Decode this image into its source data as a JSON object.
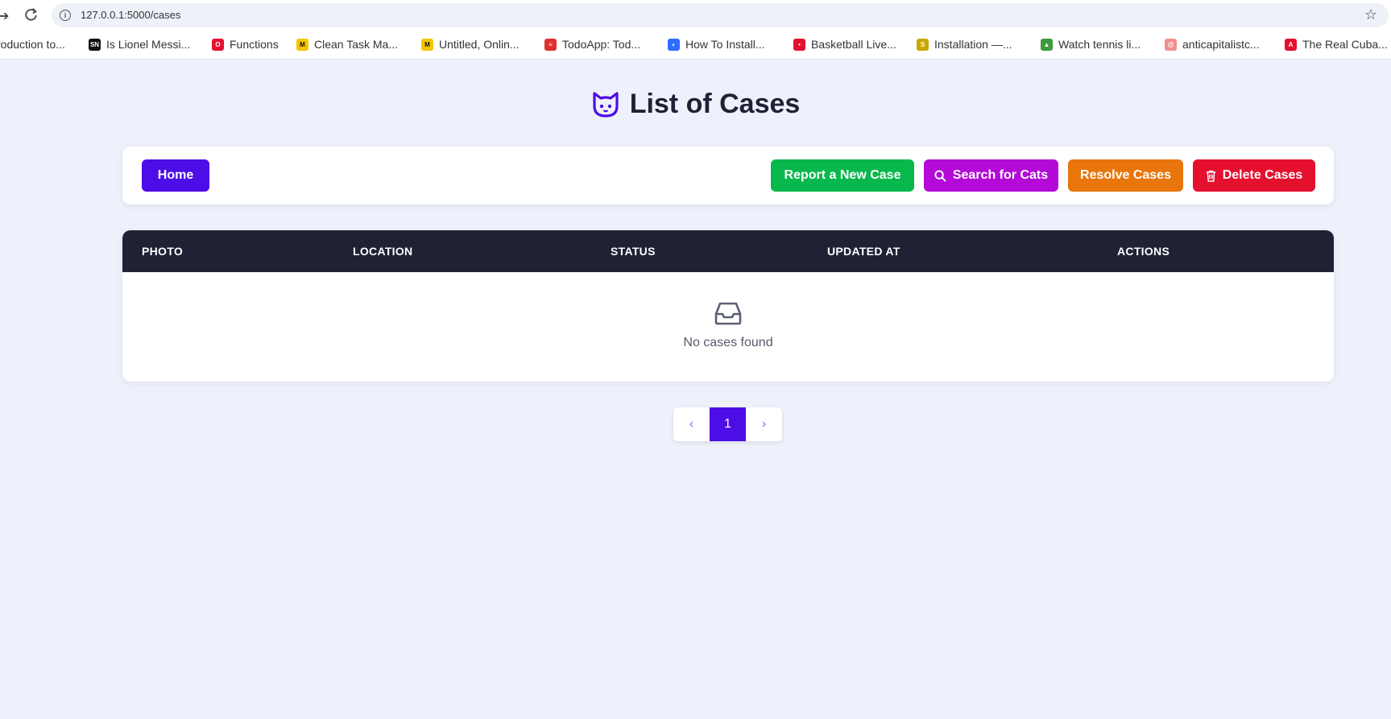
{
  "browser": {
    "url": "127.0.0.1:5000/cases",
    "bookmarks": [
      {
        "label": "roduction to...",
        "icon": "blank-icon",
        "color": "#ffffff"
      },
      {
        "label": "Is Lionel Messi...",
        "icon": "sn-icon",
        "color": "#111111"
      },
      {
        "label": "Functions",
        "icon": "oracle-icon",
        "color": "#e5102e"
      },
      {
        "label": "Clean Task Ma...",
        "icon": "miro-icon",
        "color": "#f5c400"
      },
      {
        "label": "Untitled, Onlin...",
        "icon": "miro-icon",
        "color": "#f5c400"
      },
      {
        "label": "TodoApp: Tod...",
        "icon": "todoist-icon",
        "color": "#e02f2f"
      },
      {
        "label": "How To Install...",
        "icon": "digitalocean-icon",
        "color": "#2f6bff"
      },
      {
        "label": "Basketball Live...",
        "icon": "sports-icon",
        "color": "#e5102e"
      },
      {
        "label": "Installation —...",
        "icon": "snake-icon",
        "color": "#c9a800"
      },
      {
        "label": "Watch tennis li...",
        "icon": "image-icon",
        "color": "#3c9b3c"
      },
      {
        "label": "anticapitalistc...",
        "icon": "swirl-icon",
        "color": "#f08f8f"
      },
      {
        "label": "The Real Cuba...",
        "icon": "letter-a-icon",
        "color": "#e5102e"
      }
    ]
  },
  "page": {
    "title": "List of Cases",
    "title_icon": "cat-icon"
  },
  "toolbar": {
    "home": "Home",
    "report": "Report a New Case",
    "search": "Search for Cats",
    "resolve": "Resolve Cases",
    "delete": "Delete Cases"
  },
  "table": {
    "columns": [
      "PHOTO",
      "LOCATION",
      "STATUS",
      "UPDATED AT",
      "ACTIONS"
    ],
    "empty_text": "No cases found",
    "empty_icon": "inbox-icon"
  },
  "pagination": {
    "prev": "‹",
    "current": "1",
    "next": "›"
  },
  "colors": {
    "primary": "#4c0de6",
    "success": "#08b84c",
    "search": "#b40ad8",
    "warning": "#e8760c",
    "danger": "#e5102e",
    "table_header": "#1f2235"
  }
}
